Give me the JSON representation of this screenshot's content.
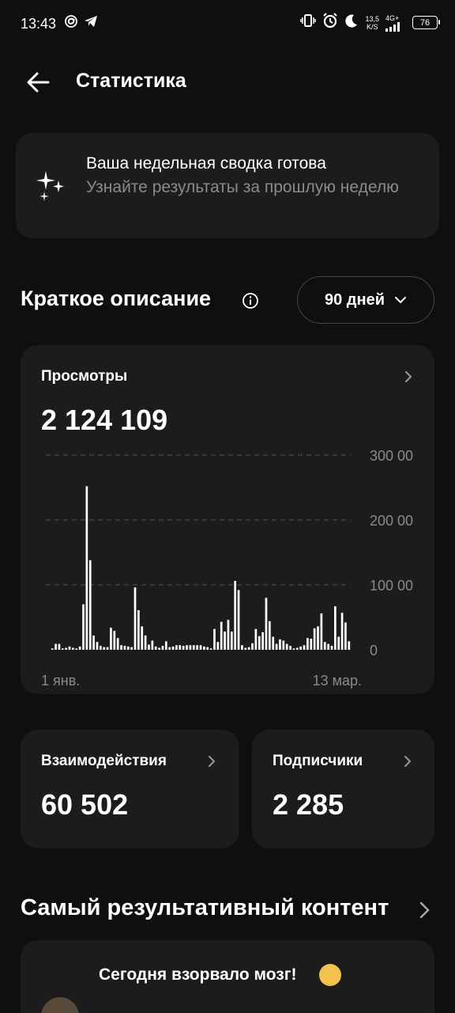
{
  "status_bar": {
    "time": "13:43",
    "net_speed_value": "13,5",
    "net_speed_unit": "K/S",
    "network": "4G+",
    "battery": "76"
  },
  "header": {
    "title": "Статистика"
  },
  "summary": {
    "title": "Ваша недельная сводка готова",
    "subtitle": "Узнайте результаты за прошлую неделю"
  },
  "overview": {
    "title": "Краткое описание",
    "period": "90 дней"
  },
  "views": {
    "label": "Просмотры",
    "value": "2 124 109"
  },
  "chart_data": {
    "type": "bar",
    "y_ticks": [
      "300 00",
      "200 00",
      "100 00",
      "0"
    ],
    "x_labels": [
      "1 янв.",
      "13 мар."
    ],
    "ylim": [
      0,
      300000
    ],
    "grid": true,
    "values": [
      2000,
      9000,
      9000,
      2000,
      3000,
      5000,
      3000,
      2000,
      5000,
      70000,
      252000,
      138000,
      22000,
      12000,
      6000,
      4000,
      4000,
      34000,
      29000,
      18000,
      7000,
      6000,
      5000,
      4000,
      96000,
      61000,
      36000,
      22000,
      8000,
      14000,
      5000,
      3000,
      6000,
      13000,
      4000,
      5000,
      7000,
      7000,
      6000,
      7000,
      7000,
      7000,
      7000,
      7000,
      5000,
      4000,
      2000,
      32000,
      12000,
      43000,
      28000,
      46000,
      28000,
      106000,
      92000,
      7000,
      3000,
      4000,
      10000,
      32000,
      21000,
      27000,
      80000,
      44000,
      20000,
      9000,
      16000,
      14000,
      9000,
      6000,
      2000,
      3000,
      5000,
      7000,
      18000,
      17000,
      33000,
      36000,
      56000,
      12000,
      9000,
      6000,
      67000,
      20000,
      57000,
      42000,
      13000
    ]
  },
  "engagement": {
    "label": "Взаимодействия",
    "value": "60 502"
  },
  "followers": {
    "label": "Подписчики",
    "value": "2 285"
  },
  "top_content": {
    "title": "Самый результативный контент",
    "first_item_text": "Сегодня взорвало мозг!"
  }
}
